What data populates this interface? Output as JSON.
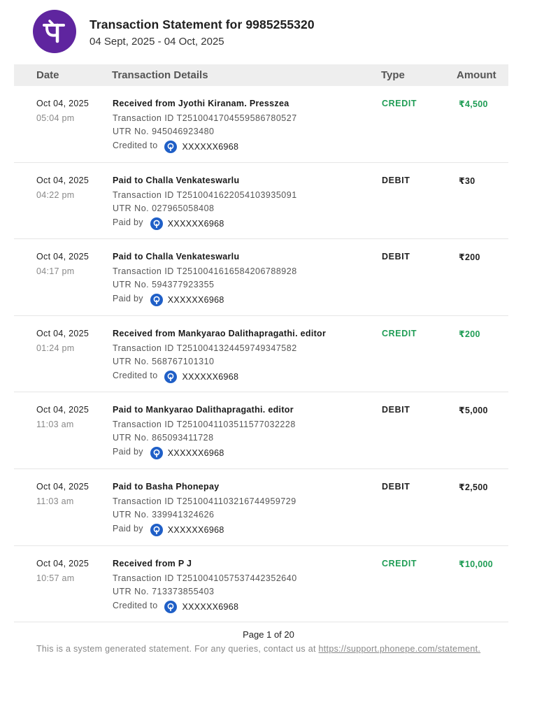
{
  "header": {
    "logo_glyph": "पे",
    "title": "Transaction Statement for 9985255320",
    "period": "04 Sept, 2025 - 04 Oct, 2025"
  },
  "columns": {
    "date": "Date",
    "details": "Transaction Details",
    "type": "Type",
    "amount": "Amount"
  },
  "colors": {
    "brand": "#5f259f",
    "credit": "#1f9d55",
    "bank_icon": "#1f5fc7"
  },
  "transactions": [
    {
      "date": "Oct 04, 2025",
      "time": "05:04 pm",
      "title": "Received from Jyothi Kiranam. Presszea",
      "txn": "Transaction ID T2510041704559586780527",
      "utr": "UTR No. 945046923480",
      "acct_label": "Credited to",
      "acct": "XXXXXX6968",
      "type": "CREDIT",
      "amount": "₹4,500"
    },
    {
      "date": "Oct 04, 2025",
      "time": "04:22 pm",
      "title": "Paid to Challa Venkateswarlu",
      "txn": "Transaction ID T2510041622054103935091",
      "utr": "UTR No. 027965058408",
      "acct_label": "Paid by",
      "acct": "XXXXXX6968",
      "type": "DEBIT",
      "amount": "₹30"
    },
    {
      "date": "Oct 04, 2025",
      "time": "04:17 pm",
      "title": "Paid to Challa Venkateswarlu",
      "txn": "Transaction ID T2510041616584206788928",
      "utr": "UTR No. 594377923355",
      "acct_label": "Paid by",
      "acct": "XXXXXX6968",
      "type": "DEBIT",
      "amount": "₹200"
    },
    {
      "date": "Oct 04, 2025",
      "time": "01:24 pm",
      "title": "Received from Mankyarao Dalithapragathi. editor",
      "txn": "Transaction ID T2510041324459749347582",
      "utr": "UTR No. 568767101310",
      "acct_label": "Credited to",
      "acct": "XXXXXX6968",
      "type": "CREDIT",
      "amount": "₹200"
    },
    {
      "date": "Oct 04, 2025",
      "time": "11:03 am",
      "title": "Paid to Mankyarao Dalithapragathi. editor",
      "txn": "Transaction ID T2510041103511577032228",
      "utr": "UTR No. 865093411728",
      "acct_label": "Paid by",
      "acct": "XXXXXX6968",
      "type": "DEBIT",
      "amount": "₹5,000"
    },
    {
      "date": "Oct 04, 2025",
      "time": "11:03 am",
      "title": "Paid to Basha Phonepay",
      "txn": "Transaction ID T2510041103216744959729",
      "utr": "UTR No. 339941324626",
      "acct_label": "Paid by",
      "acct": "XXXXXX6968",
      "type": "DEBIT",
      "amount": "₹2,500"
    },
    {
      "date": "Oct 04, 2025",
      "time": "10:57 am",
      "title": "Received from P J",
      "txn": "Transaction ID T2510041057537442352640",
      "utr": "UTR No. 713373855403",
      "acct_label": "Credited to",
      "acct": "XXXXXX6968",
      "type": "CREDIT",
      "amount": "₹10,000"
    }
  ],
  "footer": {
    "page": "Page 1 of 20",
    "note": "This is a system generated statement. For any queries, contact us at",
    "link": "https://support.phonepe.com/statement."
  }
}
